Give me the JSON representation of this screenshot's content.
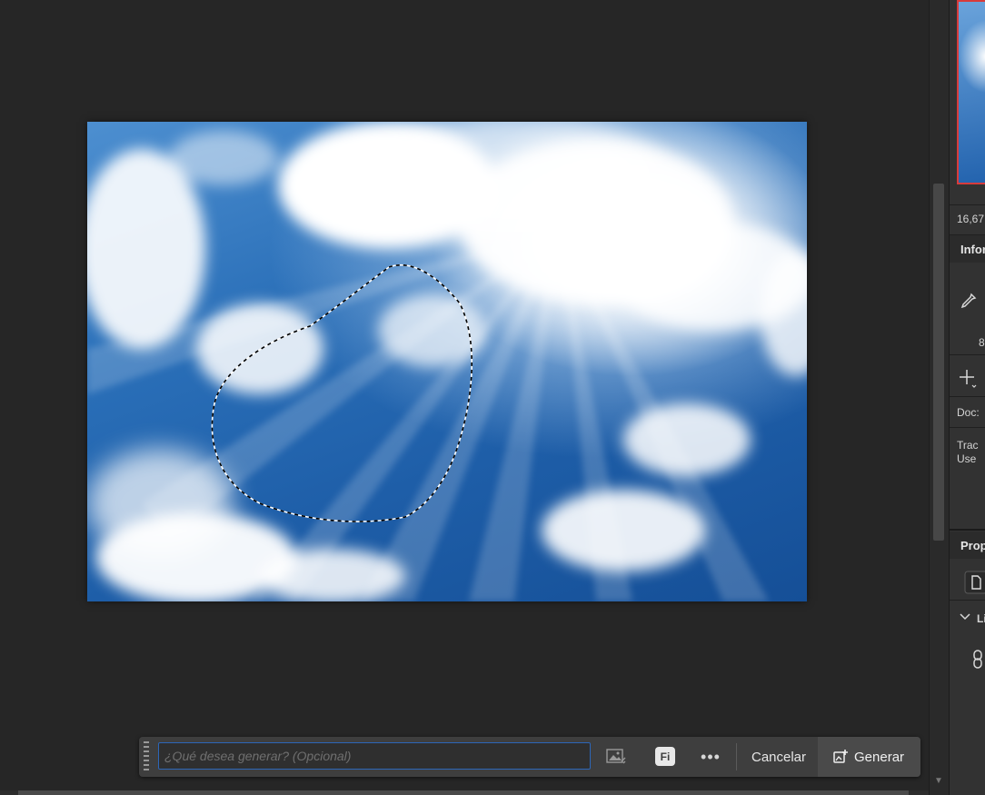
{
  "taskbar": {
    "prompt_placeholder": "¿Qué desea generar? (Opcional)",
    "prompt_value": "",
    "fi_badge": "Fi",
    "more_label": "•••",
    "cancel_label": "Cancelar",
    "generate_label": "Generar"
  },
  "right_panel": {
    "zoom_value": "16,67",
    "info_header": "Infor",
    "info_value": "8",
    "doc_label": "Doc:",
    "hint_line1": "Trac",
    "hint_line2": "Use",
    "properties_header": "Prop",
    "linked_label": "Li"
  },
  "colors": {
    "accent_focus": "#2c66b8",
    "navigator_frame": "#d83b3b",
    "app_background": "#262626"
  }
}
